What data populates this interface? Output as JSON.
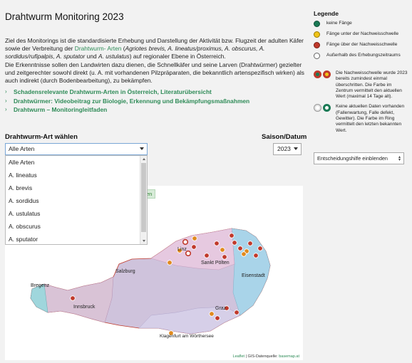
{
  "title": "Drahtwurm Monitoring 2023",
  "intro": {
    "p1_a": "Ziel des Monitorings ist die standardisierte Erhebung und Darstellung der Aktivität bzw. Flugzeit der adulten Käfer sowie der Verbreitung der ",
    "p1_link": "Drahtwurm- Arten",
    "p1_b": " (",
    "p1_species": "Agriotes brevis, A. lineatus/proximus, A. obscurus, A. sordidus/rufipalpis, A. sputator",
    "p1_c": " und ",
    "p1_species2": "A. ustulatus",
    "p1_d": ") auf regionaler Ebene in Österreich.",
    "p2": "Die Erkenntnisse sollen den Landwirten dazu dienen, die Schnellkäfer und seine Larven (Drahtwürmer) gezielter und zeitgerechter sowohl direkt (u. A. mit vorhandenen Pilzpräparaten, die bekanntlich artenspezifisch wirken) als auch indirekt (durch Bodenbearbeitung), zu bekämpfen."
  },
  "links": [
    "Schadensrelevante Drahtwurm-Arten in Österreich, Literaturübersicht",
    "Drahtwürmer: Videobeitrag zur Biologie, Erkennung und Bekämpfungsmaßnahmen",
    "Drahtwurm – Monitoringleitfaden"
  ],
  "species_select": {
    "label": "Drahtwurm-Art wählen",
    "value": "Alle Arten",
    "options": [
      "Alle Arten",
      "A. lineatus",
      "A. brevis",
      "A. sordidus",
      "A. ustulatus",
      "A. obscurus",
      "A. sputator"
    ]
  },
  "season": {
    "label": "Saison/Datum",
    "value": "2023"
  },
  "map": {
    "button_fragment": "en",
    "cities": [
      "Bregenz",
      "Innsbruck",
      "Salzburg",
      "Linz",
      "Sankt Pölten",
      "Eisenstadt",
      "Graz",
      "Klagenfurt am Wörthersee"
    ],
    "attribution_leaflet": "Leaflet",
    "attribution_rest": "| GIS-Datenquelle: ",
    "attribution_basemap": "basemap.at"
  },
  "legend": {
    "title": "Legende",
    "items": [
      {
        "label": "keine Fänge",
        "color": "#1a7a55"
      },
      {
        "label": "Fänge unter der Nachweisschwelle",
        "color": "#f0c419"
      },
      {
        "label": "Fänge über der Nachweisschwelle",
        "color": "#c0392b"
      },
      {
        "label": "Außerhalb des Erhebungszeitraums",
        "color": "#ffffff"
      }
    ],
    "note_over": "Die Nachweisschwelle wurde 2023 bereits zumindest einmal überschritten. Die Farbe im Zentrum vermittelt den aktuellen Wert (maximal 14 Tage alt).",
    "note_none": "Keine aktuellen Daten vorhanden (Fallenwartung, Falle defekt, Gewitter). Die Farbe im Ring vermittelt den letzten bekannten Wert."
  },
  "decision_select": {
    "value": "Entscheidungshilfe einblenden"
  },
  "colors": {
    "green": "#2e8b57",
    "red": "#c0392b",
    "orange": "#e08a1e",
    "yellow": "#f0c419",
    "teal": "#1a7a55"
  }
}
